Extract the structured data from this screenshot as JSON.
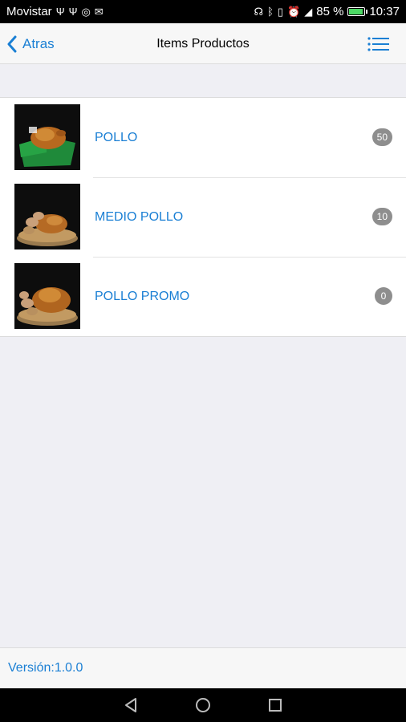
{
  "status_bar": {
    "carrier": "Movistar",
    "battery": "85 %",
    "time": "10:37"
  },
  "nav": {
    "back_label": "Atras",
    "title": "Items Productos"
  },
  "items": [
    {
      "label": "POLLO",
      "count": "50"
    },
    {
      "label": "MEDIO POLLO",
      "count": "10"
    },
    {
      "label": "POLLO PROMO",
      "count": "0"
    }
  ],
  "footer": {
    "version": "Versión:1.0.0"
  },
  "colors": {
    "accent": "#1a7fd4",
    "badge": "#8e8e8e",
    "background": "#efeff4"
  }
}
